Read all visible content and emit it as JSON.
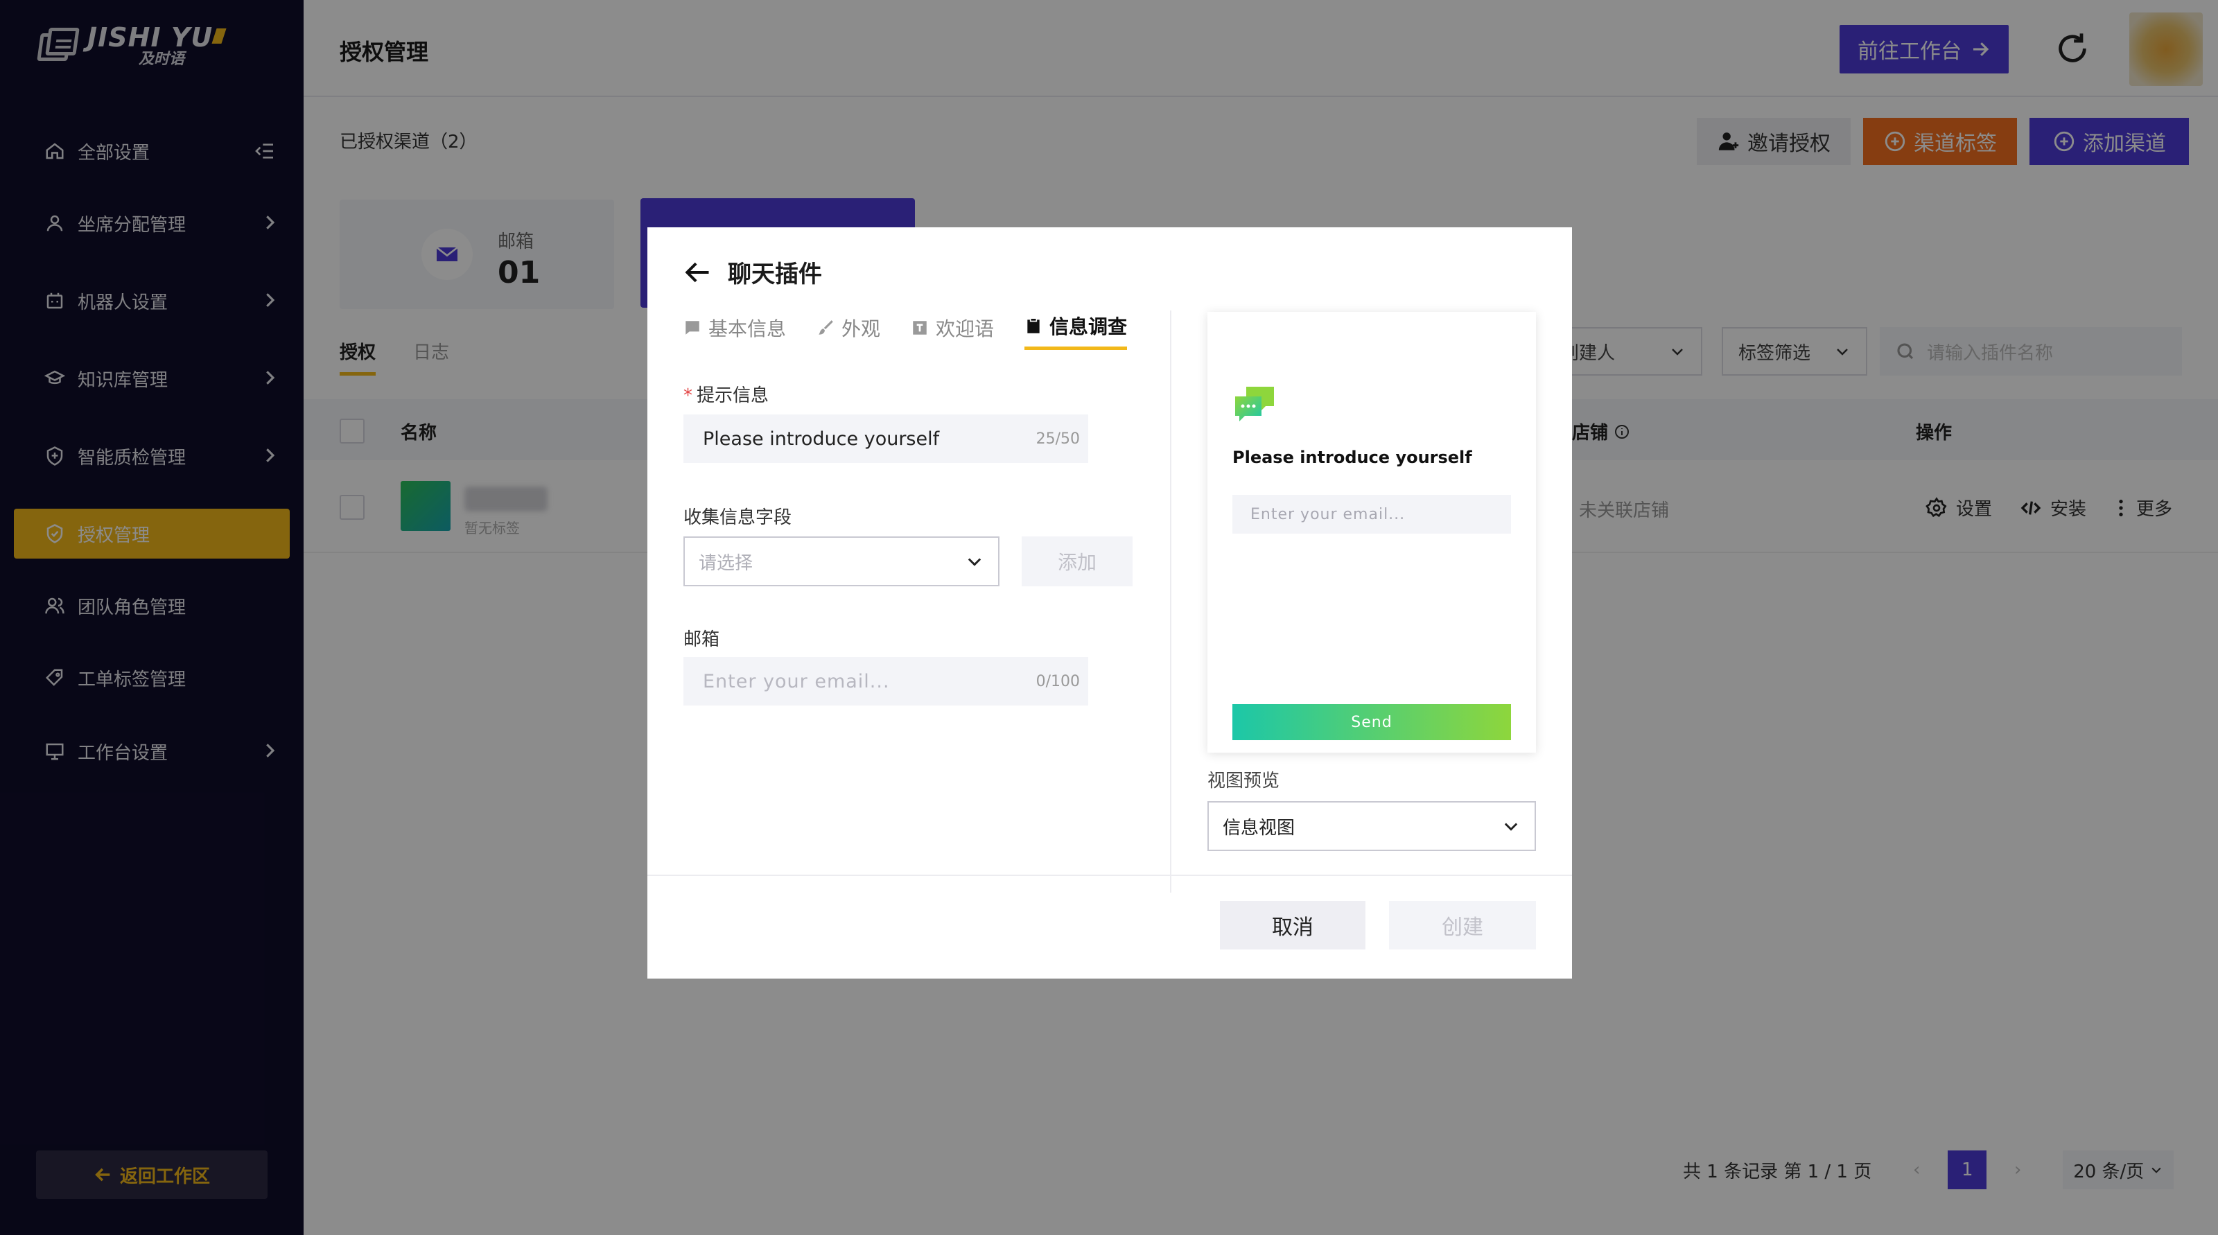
{
  "brand": {
    "name_en": "JISHI YU",
    "name_cn": "及时语"
  },
  "sidebar": {
    "items": [
      {
        "label": "全部设置",
        "icon": "home-icon"
      },
      {
        "label": "坐席分配管理",
        "icon": "user-icon"
      },
      {
        "label": "机器人设置",
        "icon": "robot-icon"
      },
      {
        "label": "知识库管理",
        "icon": "graduation-cap-icon"
      },
      {
        "label": "智能质检管理",
        "icon": "shield-plus-icon"
      },
      {
        "label": "授权管理",
        "icon": "shield-check-icon"
      },
      {
        "label": "团队角色管理",
        "icon": "team-icon"
      },
      {
        "label": "工单标签管理",
        "icon": "tag-icon"
      },
      {
        "label": "工作台设置",
        "icon": "monitor-icon"
      }
    ],
    "back_label": "返回工作区"
  },
  "header": {
    "title": "授权管理",
    "goto_label": "前往工作台"
  },
  "main": {
    "subtitle": "已授权渠道（2）",
    "invite_label": "邀请授权",
    "tag_label": "渠道标签",
    "add_label": "添加渠道",
    "card": {
      "label": "邮箱",
      "count": "01"
    },
    "tabs": [
      "授权",
      "日志"
    ],
    "filters": {
      "creator": "创建人",
      "tag": "标签筛选",
      "search_placeholder": "请输入插件名称"
    },
    "columns": {
      "name": "名称",
      "shop": "店铺",
      "ops": "操作"
    },
    "row": {
      "note": "暂无标签",
      "shop": "未关联店铺",
      "ops": [
        "设置",
        "安装",
        "更多"
      ]
    },
    "pagination": {
      "total": "共 1 条记录 第 1 / 1 页",
      "page": "1",
      "page_size": "20 条/页"
    }
  },
  "modal": {
    "title": "聊天插件",
    "tabs": [
      "基本信息",
      "外观",
      "欢迎语",
      "信息调查"
    ],
    "prompt_label": "提示信息",
    "prompt_value": "Please introduce yourself",
    "prompt_counter": "25/50",
    "collect_label": "收集信息字段",
    "collect_placeholder": "请选择",
    "collect_add": "添加",
    "email_label": "邮箱",
    "email_placeholder": "Enter your email...",
    "email_counter": "0/100",
    "preview": {
      "title": "Please introduce yourself",
      "input_placeholder": "Enter your email...",
      "send": "Send"
    },
    "view_label": "视图预览",
    "view_value": "信息视图",
    "cancel": "取消",
    "create": "创建"
  },
  "colors": {
    "sidebar_bg": "#100d2b",
    "accent_yellow": "#f2b81a",
    "primary_purple": "#4d3bd8",
    "orange": "#f4701f"
  }
}
